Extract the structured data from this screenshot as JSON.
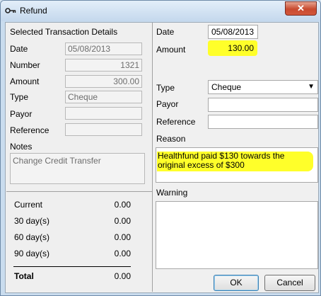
{
  "window": {
    "title": "Refund",
    "close_label": "✕"
  },
  "left": {
    "header": "Selected Transaction Details",
    "fields": [
      {
        "label": "Date",
        "value": "05/08/2013"
      },
      {
        "label": "Number",
        "value": "1321"
      },
      {
        "label": "Amount",
        "value": "300.00"
      },
      {
        "label": "Type",
        "value": "Cheque"
      },
      {
        "label": "Payor",
        "value": ""
      },
      {
        "label": "Reference",
        "value": ""
      }
    ],
    "notes_label": "Notes",
    "notes_value": "Change Credit Transfer",
    "aging": [
      {
        "label": "Current",
        "value": "0.00"
      },
      {
        "label": "30 day(s)",
        "value": "0.00"
      },
      {
        "label": "60 day(s)",
        "value": "0.00"
      },
      {
        "label": "90 day(s)",
        "value": "0.00"
      }
    ],
    "total": {
      "label": "Total",
      "value": "0.00"
    }
  },
  "right": {
    "date_label": "Date",
    "date_value": "05/08/2013",
    "amount_label": "Amount",
    "amount_value": "130.00",
    "type_label": "Type",
    "type_value": "Cheque",
    "payor_label": "Payor",
    "payor_value": "",
    "reference_label": "Reference",
    "reference_value": "",
    "reason_label": "Reason",
    "reason_value": "Healthfund paid $130 towards the original excess of $300",
    "warning_label": "Warning",
    "warning_value": ""
  },
  "buttons": {
    "ok": "OK",
    "cancel": "Cancel"
  },
  "colors": {
    "highlight": "#ffff2a",
    "title_bar": "#c4d8ed",
    "close_button": "#c84a2f"
  }
}
